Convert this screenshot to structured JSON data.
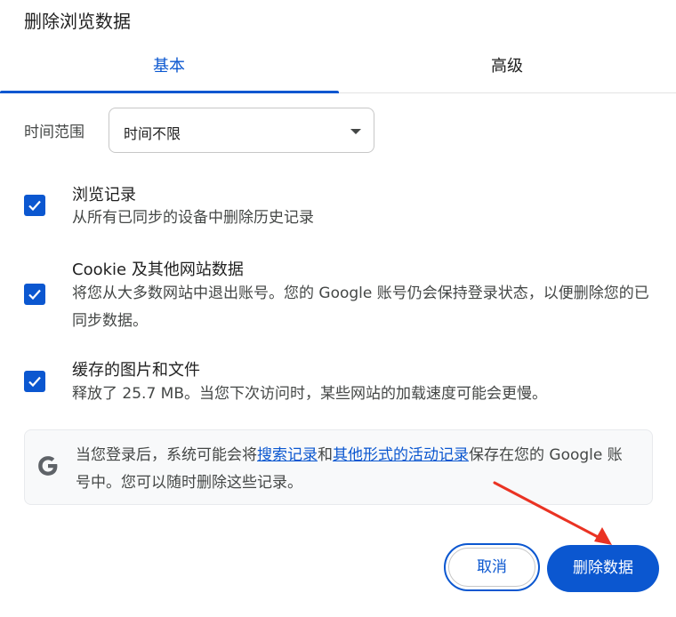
{
  "dialog": {
    "title": "删除浏览数据"
  },
  "tabs": [
    {
      "label": "基本",
      "active": true
    },
    {
      "label": "高级",
      "active": false
    }
  ],
  "time_range": {
    "label": "时间范围",
    "selected": "时间不限"
  },
  "options": [
    {
      "title": "浏览记录",
      "description": "从所有已同步的设备中删除历史记录",
      "checked": true
    },
    {
      "title": "Cookie 及其他网站数据",
      "description": "将您从大多数网站中退出账号。您的 Google 账号仍会保持登录状态，以便删除您的已同步数据。",
      "checked": true
    },
    {
      "title": "缓存的图片和文件",
      "description": "释放了 25.7 MB。当您下次访问时，某些网站的加载速度可能会更慢。",
      "checked": true
    }
  ],
  "info": {
    "text_before": "当您登录后，系统可能会将",
    "link1": "搜索记录",
    "text_mid": "和",
    "link2": "其他形式的活动记录",
    "text_after": "保存在您的 Google 账号中。您可以随时删除这些记录。"
  },
  "buttons": {
    "cancel": "取消",
    "delete": "删除数据"
  },
  "colors": {
    "accent": "#0b57d0",
    "annotation": "#ea3323"
  },
  "icons": {
    "checkbox": "check-icon",
    "info": "google-g-icon",
    "dropdown": "caret-down-icon"
  }
}
